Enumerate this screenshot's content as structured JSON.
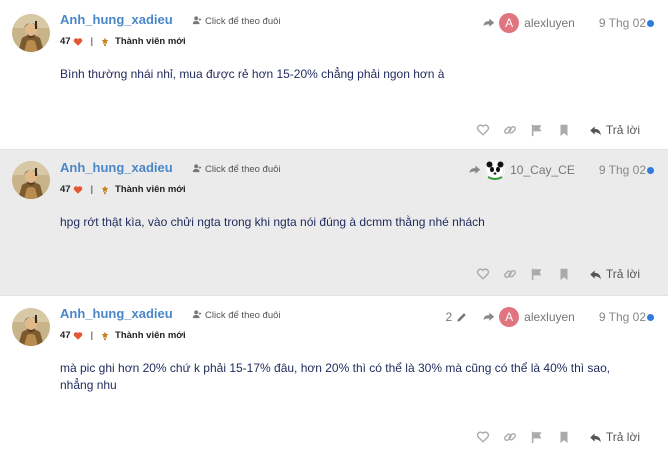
{
  "posts": [
    {
      "username": "Anh_hung_xadieu",
      "follow_label": "Click để theo đuôi",
      "likes": "47",
      "title": "Thành viên mới",
      "content": "Bình thường nhái nhỉ, mua được rẻ hơn 15-20% chẳng phải ngon hơn à",
      "reply_to_initial": "A",
      "reply_to_name": "alexluyen",
      "date": "9 Thg 02",
      "reply_label": "Trả lời"
    },
    {
      "username": "Anh_hung_xadieu",
      "follow_label": "Click để theo đuôi",
      "likes": "47",
      "title": "Thành viên mới",
      "content": "hpg rớt thật kìa, vào chửi ngta trong khi ngta nói đúng à dcmm thằng nhé nhách",
      "reply_to_name": "10_Cay_CE",
      "date": "9 Thg 02",
      "reply_label": "Trả lời"
    },
    {
      "username": "Anh_hung_xadieu",
      "follow_label": "Click để theo đuôi",
      "likes": "47",
      "title": "Thành viên mới",
      "content": "mà pic ghi hơn 20% chứ k phải 15-17% đâu, hơn 20% thì có thể là 30% mà cũng có thể là 40% thì sao, nhẳng nhu",
      "edit_count": "2",
      "reply_to_initial": "A",
      "reply_to_name": "alexluyen",
      "date": "9 Thg 02",
      "reply_label": "Trả lời"
    }
  ],
  "colors": {
    "username": "#4a86c8",
    "content_text": "#1f2a5c",
    "heart": "#e45735",
    "reply_avatar": "#e0747f",
    "unread_dot": "#2e7ae0",
    "highlight_bg": "#ebebeb"
  }
}
